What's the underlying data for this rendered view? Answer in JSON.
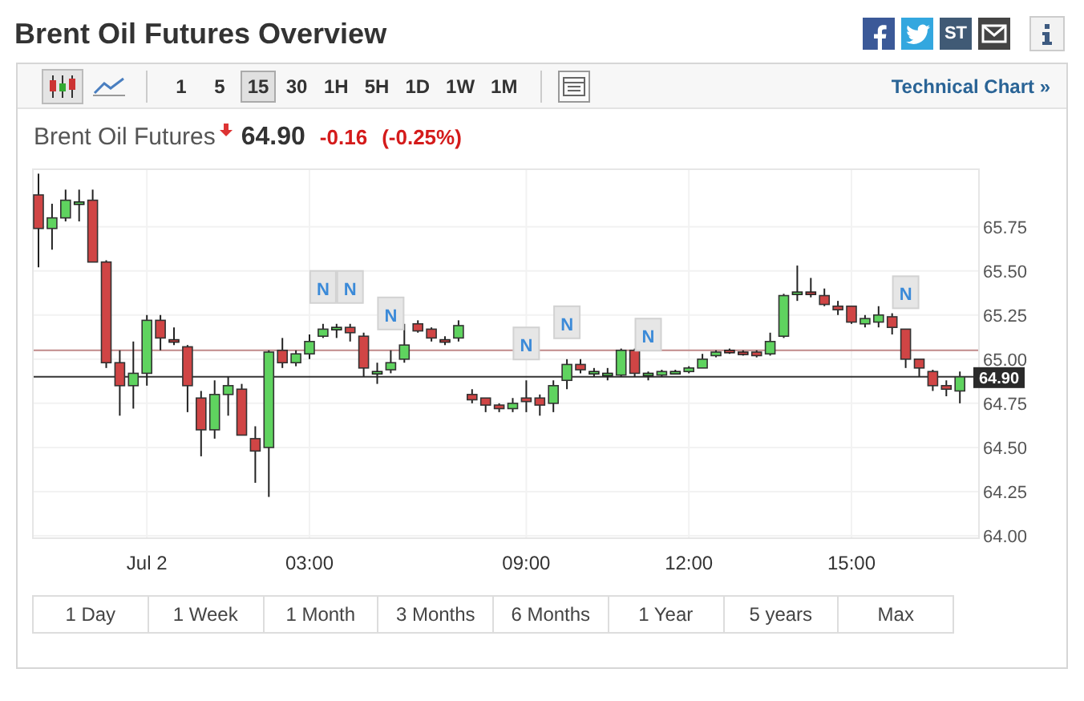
{
  "title": "Brent Oil Futures Overview",
  "share_icons": [
    {
      "kind": "facebook"
    },
    {
      "kind": "twitter"
    },
    {
      "kind": "stocktwits",
      "label": "ST"
    },
    {
      "kind": "mail"
    },
    {
      "kind": "info"
    }
  ],
  "toolbar": {
    "chart_types": [
      {
        "kind": "candles",
        "selected": true
      },
      {
        "kind": "line",
        "selected": false
      }
    ],
    "intervals": [
      {
        "label": "1",
        "selected": false
      },
      {
        "label": "5",
        "selected": false
      },
      {
        "label": "15",
        "selected": true
      },
      {
        "label": "30",
        "selected": false
      },
      {
        "label": "1H",
        "selected": false
      },
      {
        "label": "5H",
        "selected": false
      },
      {
        "label": "1D",
        "selected": false
      },
      {
        "label": "1W",
        "selected": false
      },
      {
        "label": "1M",
        "selected": false
      }
    ],
    "link": "Technical Chart »"
  },
  "quote": {
    "name": "Brent Oil Futures",
    "falling": true,
    "price": "64.90",
    "change": "-0.16",
    "change_pct": "(-0.25%)"
  },
  "chart_data": {
    "type": "candlestick",
    "grid": true,
    "ylim": [
      64.0,
      66.08
    ],
    "yticks": [
      {
        "value": 64.0,
        "label": "64.00"
      },
      {
        "value": 64.25,
        "label": "64.25"
      },
      {
        "value": 64.5,
        "label": "64.50"
      },
      {
        "value": 64.75,
        "label": "64.75"
      },
      {
        "value": 65.0,
        "label": "65.00"
      },
      {
        "value": 65.25,
        "label": "65.25"
      },
      {
        "value": 65.5,
        "label": "65.50"
      },
      {
        "value": 65.75,
        "label": "65.75"
      }
    ],
    "categories": [
      null,
      null,
      null,
      null,
      null,
      null,
      null,
      null,
      "Jul 2",
      null,
      null,
      null,
      null,
      null,
      null,
      null,
      null,
      null,
      null,
      null,
      "03:00",
      null,
      null,
      null,
      null,
      null,
      null,
      null,
      null,
      null,
      null,
      null,
      null,
      null,
      null,
      null,
      "09:00",
      null,
      null,
      null,
      null,
      null,
      null,
      null,
      null,
      null,
      null,
      null,
      "12:00",
      null,
      null,
      null,
      null,
      null,
      null,
      null,
      null,
      null,
      null,
      null,
      "15:00",
      null,
      null,
      null,
      null,
      null,
      null,
      null,
      null
    ],
    "ohlc": [
      [
        65.93,
        66.05,
        65.52,
        65.74
      ],
      [
        65.74,
        65.88,
        65.62,
        65.8
      ],
      [
        65.8,
        65.96,
        65.78,
        65.9
      ],
      [
        65.88,
        65.96,
        65.78,
        65.89
      ],
      [
        65.9,
        65.96,
        65.55,
        65.55
      ],
      [
        65.55,
        65.56,
        64.95,
        64.98
      ],
      [
        64.98,
        65.05,
        64.68,
        64.85
      ],
      [
        64.85,
        65.1,
        64.72,
        64.92
      ],
      [
        64.92,
        65.25,
        64.85,
        65.22
      ],
      [
        65.22,
        65.25,
        65.05,
        65.12
      ],
      [
        65.11,
        65.18,
        65.08,
        65.1
      ],
      [
        65.07,
        65.08,
        64.7,
        64.85
      ],
      [
        64.78,
        64.82,
        64.45,
        64.6
      ],
      [
        64.6,
        64.88,
        64.55,
        64.8
      ],
      [
        64.8,
        64.9,
        64.68,
        64.85
      ],
      [
        64.83,
        64.86,
        64.57,
        64.57
      ],
      [
        64.55,
        64.62,
        64.3,
        64.48
      ],
      [
        64.5,
        65.05,
        64.22,
        65.04
      ],
      [
        65.05,
        65.12,
        64.95,
        64.98
      ],
      [
        64.98,
        65.05,
        64.96,
        65.03
      ],
      [
        65.03,
        65.14,
        65.0,
        65.1
      ],
      [
        65.13,
        65.2,
        65.12,
        65.17
      ],
      [
        65.18,
        65.2,
        65.12,
        65.18
      ],
      [
        65.18,
        65.2,
        65.1,
        65.15
      ],
      [
        65.13,
        65.15,
        64.9,
        64.95
      ],
      [
        64.93,
        64.98,
        64.86,
        64.93
      ],
      [
        64.94,
        65.05,
        64.92,
        64.98
      ],
      [
        65.0,
        65.2,
        64.98,
        65.08
      ],
      [
        65.2,
        65.22,
        65.15,
        65.16
      ],
      [
        65.17,
        65.18,
        65.1,
        65.12
      ],
      [
        65.11,
        65.13,
        65.08,
        65.1
      ],
      [
        65.12,
        65.22,
        65.1,
        65.19
      ],
      [
        64.8,
        64.83,
        64.75,
        64.77
      ],
      [
        64.78,
        64.78,
        64.7,
        64.74
      ],
      [
        64.74,
        64.75,
        64.7,
        64.72
      ],
      [
        64.72,
        64.78,
        64.7,
        64.75
      ],
      [
        64.78,
        64.88,
        64.7,
        64.76
      ],
      [
        64.78,
        64.8,
        64.68,
        64.74
      ],
      [
        64.75,
        64.88,
        64.7,
        64.85
      ],
      [
        64.88,
        65.0,
        64.83,
        64.97
      ],
      [
        64.97,
        65.0,
        64.92,
        64.94
      ],
      [
        64.93,
        64.95,
        64.9,
        64.93
      ],
      [
        64.92,
        64.95,
        64.88,
        64.92
      ],
      [
        64.91,
        65.06,
        64.9,
        65.05
      ],
      [
        65.05,
        65.06,
        64.9,
        64.92
      ],
      [
        64.92,
        64.93,
        64.88,
        64.92
      ],
      [
        64.91,
        64.94,
        64.9,
        64.93
      ],
      [
        64.93,
        64.94,
        64.92,
        64.93
      ],
      [
        64.93,
        64.96,
        64.92,
        64.95
      ],
      [
        64.95,
        65.03,
        64.95,
        65.0
      ],
      [
        65.02,
        65.05,
        65.01,
        65.04
      ],
      [
        65.05,
        65.06,
        65.03,
        65.04
      ],
      [
        65.04,
        65.05,
        65.02,
        65.03
      ],
      [
        65.04,
        65.05,
        65.01,
        65.02
      ],
      [
        65.03,
        65.15,
        65.02,
        65.1
      ],
      [
        65.13,
        65.37,
        65.12,
        65.36
      ],
      [
        65.38,
        65.53,
        65.33,
        65.38
      ],
      [
        65.38,
        65.46,
        65.35,
        65.37
      ],
      [
        65.36,
        65.4,
        65.3,
        65.31
      ],
      [
        65.3,
        65.33,
        65.25,
        65.28
      ],
      [
        65.3,
        65.3,
        65.2,
        65.21
      ],
      [
        65.2,
        65.25,
        65.18,
        65.23
      ],
      [
        65.21,
        65.3,
        65.18,
        65.25
      ],
      [
        65.24,
        65.26,
        65.14,
        65.18
      ],
      [
        65.17,
        65.17,
        64.95,
        65.0
      ],
      [
        65.0,
        65.0,
        64.9,
        64.95
      ],
      [
        64.93,
        64.94,
        64.82,
        64.85
      ],
      [
        64.85,
        64.88,
        64.79,
        64.83
      ],
      [
        64.82,
        64.93,
        64.75,
        64.9
      ]
    ],
    "ref_lines": [
      {
        "axis": "y",
        "value": 65.05,
        "color": "#c08a8a"
      },
      {
        "axis": "y",
        "value": 64.9,
        "color": "#333333",
        "label": "64.90"
      }
    ],
    "annotations": [
      {
        "text": "N"
      },
      {
        "text": "N"
      },
      {
        "text": "N"
      },
      {
        "text": "N"
      },
      {
        "text": "N"
      },
      {
        "text": "N"
      },
      {
        "text": "N"
      }
    ]
  },
  "ranges": [
    {
      "label": "1 Day"
    },
    {
      "label": "1 Week"
    },
    {
      "label": "1 Month"
    },
    {
      "label": "3 Months"
    },
    {
      "label": "6 Months"
    },
    {
      "label": "1 Year"
    },
    {
      "label": "5 years"
    },
    {
      "label": "Max"
    }
  ]
}
